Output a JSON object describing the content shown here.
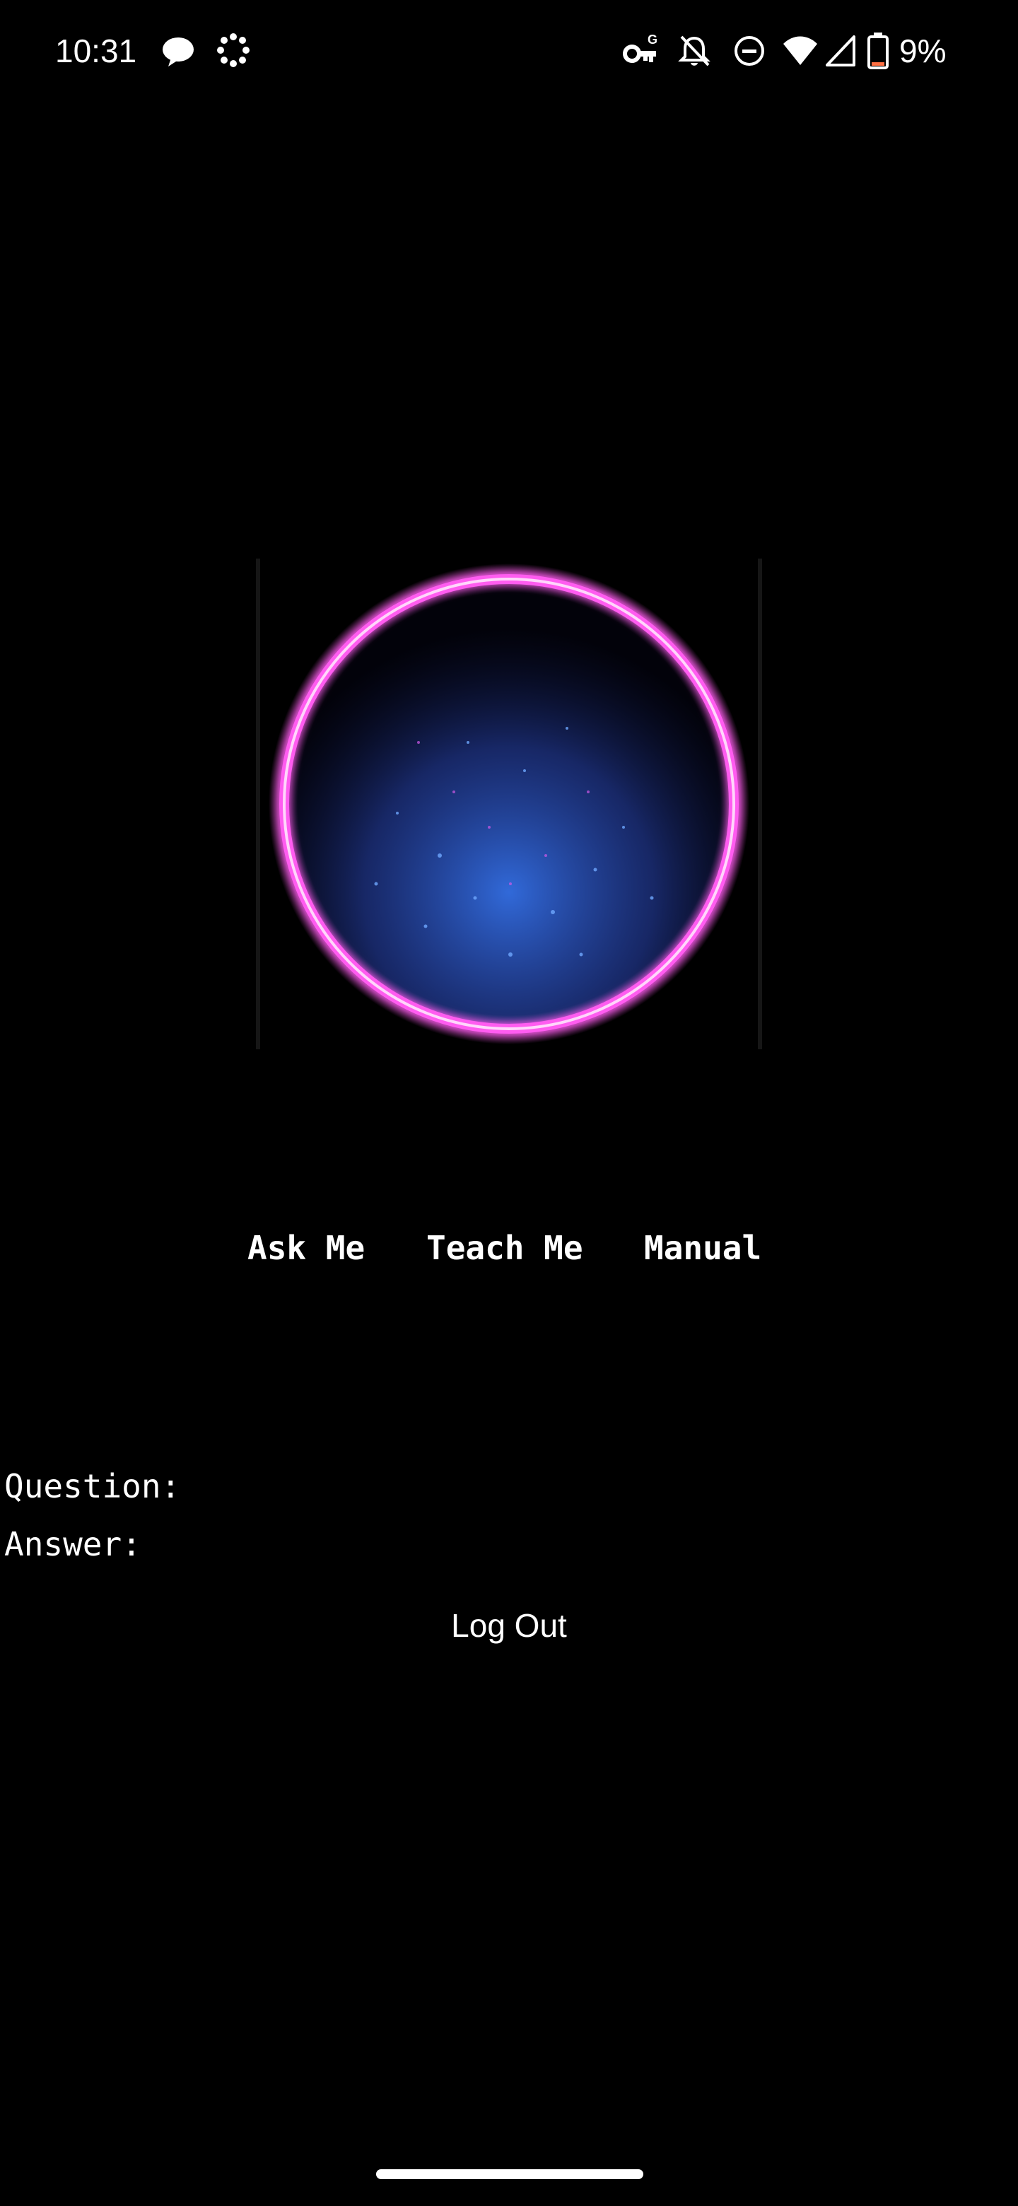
{
  "status_bar": {
    "time": "10:31",
    "battery_percent": "9%",
    "icons_left": [
      "chat-bubble-icon",
      "loading-dots-icon"
    ],
    "icons_right": [
      "vpn-key-icon",
      "notifications-off-icon",
      "do-not-disturb-icon",
      "wifi-icon",
      "cell-signal-icon",
      "battery-low-icon"
    ]
  },
  "orb": {
    "ring_color": "#ff5cf0",
    "core_color": "#3a7cff"
  },
  "modes": {
    "ask": "Ask Me",
    "teach": "Teach Me",
    "manual": "Manual"
  },
  "qa": {
    "question_label": "Question:",
    "question_value": "",
    "answer_label": "Answer:",
    "answer_value": ""
  },
  "auth": {
    "logout_label": "Log Out"
  },
  "colors": {
    "background": "#000000",
    "text": "#ffffff"
  }
}
